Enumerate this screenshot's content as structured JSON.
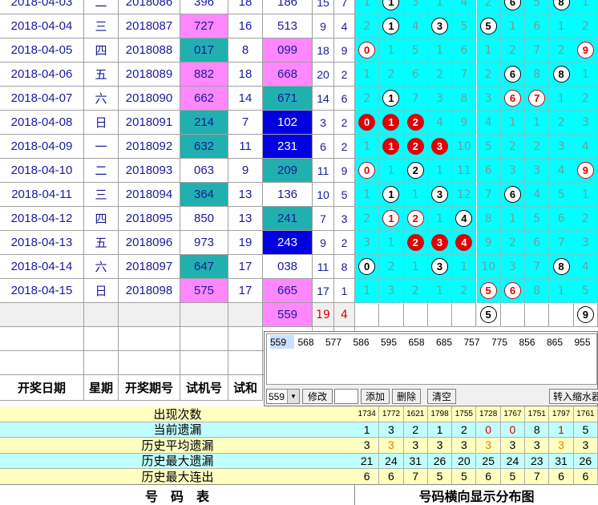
{
  "columns": [
    "开奖日期",
    "星期",
    "开奖期号",
    "试机号",
    "试和"
  ],
  "rows": [
    {
      "date": "2018-04-03",
      "week": "二",
      "issue": "2018086",
      "sj": "396",
      "sjh": "18",
      "kj": "186",
      "kjh": "15",
      "kd": "7",
      "dist": [
        {
          "t": "1",
          "k": "n"
        },
        {
          "t": "1",
          "k": "w"
        },
        {
          "t": "3",
          "k": "n"
        },
        {
          "t": "1",
          "k": "n"
        },
        {
          "t": "4",
          "k": "n"
        },
        {
          "t": "2",
          "k": "n"
        },
        {
          "t": "6",
          "k": "w"
        },
        {
          "t": "5",
          "k": "n"
        },
        {
          "t": "8",
          "k": "w"
        },
        {
          "t": "1",
          "k": "n"
        }
      ]
    },
    {
      "date": "2018-04-04",
      "week": "三",
      "issue": "2018087",
      "sj": "727",
      "sjh": "16",
      "kj": "513",
      "kjh": "9",
      "kd": "4",
      "dist": [
        {
          "t": "2",
          "k": "n"
        },
        {
          "t": "1",
          "k": "w"
        },
        {
          "t": "4",
          "k": "n"
        },
        {
          "t": "3",
          "k": "w"
        },
        {
          "t": "5",
          "k": "n"
        },
        {
          "t": "5",
          "k": "w"
        },
        {
          "t": "1",
          "k": "n"
        },
        {
          "t": "6",
          "k": "n"
        },
        {
          "t": "1",
          "k": "n"
        },
        {
          "t": "2",
          "k": "n"
        }
      ]
    },
    {
      "date": "2018-04-05",
      "week": "四",
      "issue": "2018088",
      "sj": "017",
      "sjh": "8",
      "kj": "099",
      "kjh": "18",
      "kd": "9",
      "dist": [
        {
          "t": "0",
          "k": "wr"
        },
        {
          "t": "1",
          "k": "n"
        },
        {
          "t": "5",
          "k": "n"
        },
        {
          "t": "1",
          "k": "n"
        },
        {
          "t": "6",
          "k": "n"
        },
        {
          "t": "1",
          "k": "n"
        },
        {
          "t": "2",
          "k": "n"
        },
        {
          "t": "7",
          "k": "n"
        },
        {
          "t": "2",
          "k": "n"
        },
        {
          "t": "9",
          "k": "wr"
        }
      ]
    },
    {
      "date": "2018-04-06",
      "week": "五",
      "issue": "2018089",
      "sj": "882",
      "sjh": "18",
      "kj": "668",
      "kjh": "20",
      "kd": "2",
      "dist": [
        {
          "t": "1",
          "k": "n"
        },
        {
          "t": "2",
          "k": "n"
        },
        {
          "t": "6",
          "k": "n"
        },
        {
          "t": "2",
          "k": "n"
        },
        {
          "t": "7",
          "k": "n"
        },
        {
          "t": "2",
          "k": "n"
        },
        {
          "t": "6",
          "k": "w"
        },
        {
          "t": "8",
          "k": "n"
        },
        {
          "t": "8",
          "k": "w"
        },
        {
          "t": "1",
          "k": "n"
        }
      ]
    },
    {
      "date": "2018-04-07",
      "week": "六",
      "issue": "2018090",
      "sj": "662",
      "sjh": "14",
      "kj": "671",
      "kjh": "14",
      "kd": "6",
      "dist": [
        {
          "t": "2",
          "k": "n"
        },
        {
          "t": "1",
          "k": "w"
        },
        {
          "t": "7",
          "k": "n"
        },
        {
          "t": "3",
          "k": "n"
        },
        {
          "t": "8",
          "k": "n"
        },
        {
          "t": "3",
          "k": "n"
        },
        {
          "t": "6",
          "k": "wr"
        },
        {
          "t": "7",
          "k": "wr"
        },
        {
          "t": "1",
          "k": "n"
        },
        {
          "t": "2",
          "k": "n"
        }
      ]
    },
    {
      "date": "2018-04-08",
      "week": "日",
      "issue": "2018091",
      "sj": "214",
      "sjh": "7",
      "kj": "102",
      "kjh": "3",
      "kd": "2",
      "dist": [
        {
          "t": "0",
          "k": "r"
        },
        {
          "t": "1",
          "k": "r"
        },
        {
          "t": "2",
          "k": "r"
        },
        {
          "t": "4",
          "k": "n"
        },
        {
          "t": "9",
          "k": "n"
        },
        {
          "t": "4",
          "k": "n"
        },
        {
          "t": "1",
          "k": "n"
        },
        {
          "t": "1",
          "k": "n"
        },
        {
          "t": "2",
          "k": "n"
        },
        {
          "t": "3",
          "k": "n"
        }
      ]
    },
    {
      "date": "2018-04-09",
      "week": "一",
      "issue": "2018092",
      "sj": "632",
      "sjh": "11",
      "kj": "231",
      "kjh": "6",
      "kd": "2",
      "dist": [
        {
          "t": "1",
          "k": "n"
        },
        {
          "t": "1",
          "k": "r"
        },
        {
          "t": "2",
          "k": "r"
        },
        {
          "t": "3",
          "k": "r"
        },
        {
          "t": "10",
          "k": "n"
        },
        {
          "t": "5",
          "k": "n"
        },
        {
          "t": "2",
          "k": "n"
        },
        {
          "t": "2",
          "k": "n"
        },
        {
          "t": "3",
          "k": "n"
        },
        {
          "t": "4",
          "k": "n"
        }
      ]
    },
    {
      "date": "2018-04-10",
      "week": "二",
      "issue": "2018093",
      "sj": "063",
      "sjh": "9",
      "kj": "209",
      "kjh": "11",
      "kd": "9",
      "dist": [
        {
          "t": "0",
          "k": "wr"
        },
        {
          "t": "1",
          "k": "n"
        },
        {
          "t": "2",
          "k": "w"
        },
        {
          "t": "1",
          "k": "n"
        },
        {
          "t": "11",
          "k": "n"
        },
        {
          "t": "6",
          "k": "n"
        },
        {
          "t": "3",
          "k": "n"
        },
        {
          "t": "3",
          "k": "n"
        },
        {
          "t": "4",
          "k": "n"
        },
        {
          "t": "9",
          "k": "wr"
        }
      ]
    },
    {
      "date": "2018-04-11",
      "week": "三",
      "issue": "2018094",
      "sj": "364",
      "sjh": "13",
      "kj": "136",
      "kjh": "10",
      "kd": "5",
      "dist": [
        {
          "t": "1",
          "k": "n"
        },
        {
          "t": "1",
          "k": "w"
        },
        {
          "t": "1",
          "k": "n"
        },
        {
          "t": "3",
          "k": "w"
        },
        {
          "t": "12",
          "k": "n"
        },
        {
          "t": "7",
          "k": "n"
        },
        {
          "t": "6",
          "k": "w"
        },
        {
          "t": "4",
          "k": "n"
        },
        {
          "t": "5",
          "k": "n"
        },
        {
          "t": "1",
          "k": "n"
        }
      ]
    },
    {
      "date": "2018-04-12",
      "week": "四",
      "issue": "2018095",
      "sj": "850",
      "sjh": "13",
      "kj": "241",
      "kjh": "7",
      "kd": "3",
      "dist": [
        {
          "t": "2",
          "k": "n"
        },
        {
          "t": "1",
          "k": "wr"
        },
        {
          "t": "2",
          "k": "wr"
        },
        {
          "t": "1",
          "k": "n"
        },
        {
          "t": "4",
          "k": "w"
        },
        {
          "t": "8",
          "k": "n"
        },
        {
          "t": "1",
          "k": "n"
        },
        {
          "t": "5",
          "k": "n"
        },
        {
          "t": "6",
          "k": "n"
        },
        {
          "t": "2",
          "k": "n"
        }
      ]
    },
    {
      "date": "2018-04-13",
      "week": "五",
      "issue": "2018096",
      "sj": "973",
      "sjh": "19",
      "kj": "243",
      "kjh": "9",
      "kd": "2",
      "dist": [
        {
          "t": "3",
          "k": "n"
        },
        {
          "t": "1",
          "k": "n"
        },
        {
          "t": "2",
          "k": "r"
        },
        {
          "t": "3",
          "k": "r"
        },
        {
          "t": "4",
          "k": "r"
        },
        {
          "t": "9",
          "k": "n"
        },
        {
          "t": "2",
          "k": "n"
        },
        {
          "t": "6",
          "k": "n"
        },
        {
          "t": "7",
          "k": "n"
        },
        {
          "t": "3",
          "k": "n"
        }
      ]
    },
    {
      "date": "2018-04-14",
      "week": "六",
      "issue": "2018097",
      "sj": "647",
      "sjh": "17",
      "kj": "038",
      "kjh": "11",
      "kd": "8",
      "dist": [
        {
          "t": "0",
          "k": "w"
        },
        {
          "t": "2",
          "k": "n"
        },
        {
          "t": "1",
          "k": "n"
        },
        {
          "t": "3",
          "k": "w"
        },
        {
          "t": "1",
          "k": "n"
        },
        {
          "t": "10",
          "k": "n"
        },
        {
          "t": "3",
          "k": "n"
        },
        {
          "t": "7",
          "k": "n"
        },
        {
          "t": "8",
          "k": "w"
        },
        {
          "t": "4",
          "k": "n"
        }
      ]
    },
    {
      "date": "2018-04-15",
      "week": "日",
      "issue": "2018098",
      "sj": "575",
      "sjh": "17",
      "kj": "665",
      "kjh": "17",
      "kd": "1",
      "dist": [
        {
          "t": "1",
          "k": "n"
        },
        {
          "t": "3",
          "k": "n"
        },
        {
          "t": "2",
          "k": "n"
        },
        {
          "t": "1",
          "k": "n"
        },
        {
          "t": "2",
          "k": "n"
        },
        {
          "t": "5",
          "k": "wr"
        },
        {
          "t": "6",
          "k": "wr"
        },
        {
          "t": "8",
          "k": "n"
        },
        {
          "t": "1",
          "k": "n"
        },
        {
          "t": "5",
          "k": "n"
        }
      ]
    }
  ],
  "forecast": {
    "kj": "559",
    "kjh": "19",
    "kd": "4",
    "circles": [
      {
        "t": "5",
        "col": 5
      },
      {
        "t": "9",
        "col": 9
      }
    ]
  },
  "dialog": {
    "items": [
      "559",
      "568",
      "577",
      "586",
      "595",
      "658",
      "685",
      "757",
      "775",
      "856",
      "865",
      "955"
    ],
    "select_value": "559",
    "btn_modify": "修改",
    "btn_add": "添加",
    "btn_delete": "删除",
    "btn_clear": "清空",
    "btn_transfer": "转入缩水器"
  },
  "stats": [
    {
      "label": "出现次数",
      "vals": [
        "1734",
        "1772",
        "1621",
        "1798",
        "1755",
        "1728",
        "1767",
        "1751",
        "1797",
        "1761"
      ]
    },
    {
      "label": "当前遗漏",
      "vals": [
        "1",
        "3",
        "2",
        "1",
        "2",
        "0",
        "0",
        "8",
        "1",
        "5"
      ]
    },
    {
      "label": "历史平均遗漏",
      "vals": [
        "3",
        "3",
        "3",
        "3",
        "3",
        "3",
        "3",
        "3",
        "3",
        "3"
      ]
    },
    {
      "label": "历史最大遗漏",
      "vals": [
        "21",
        "24",
        "31",
        "26",
        "20",
        "25",
        "24",
        "23",
        "31",
        "26"
      ]
    },
    {
      "label": "历史最大连出",
      "vals": [
        "6",
        "6",
        "7",
        "5",
        "5",
        "6",
        "5",
        "7",
        "6",
        "6"
      ]
    }
  ],
  "footer": {
    "left": "号　码　表",
    "right": "号码横向显示分布图"
  },
  "colors": {
    "cyan": "#00ffff",
    "magenta": "#ff88ff",
    "teal": "#20b0b0",
    "blue": "#0000e0",
    "red": "#e00000",
    "statYellow": "#ffffc0",
    "statCyan": "#c0ffff"
  }
}
